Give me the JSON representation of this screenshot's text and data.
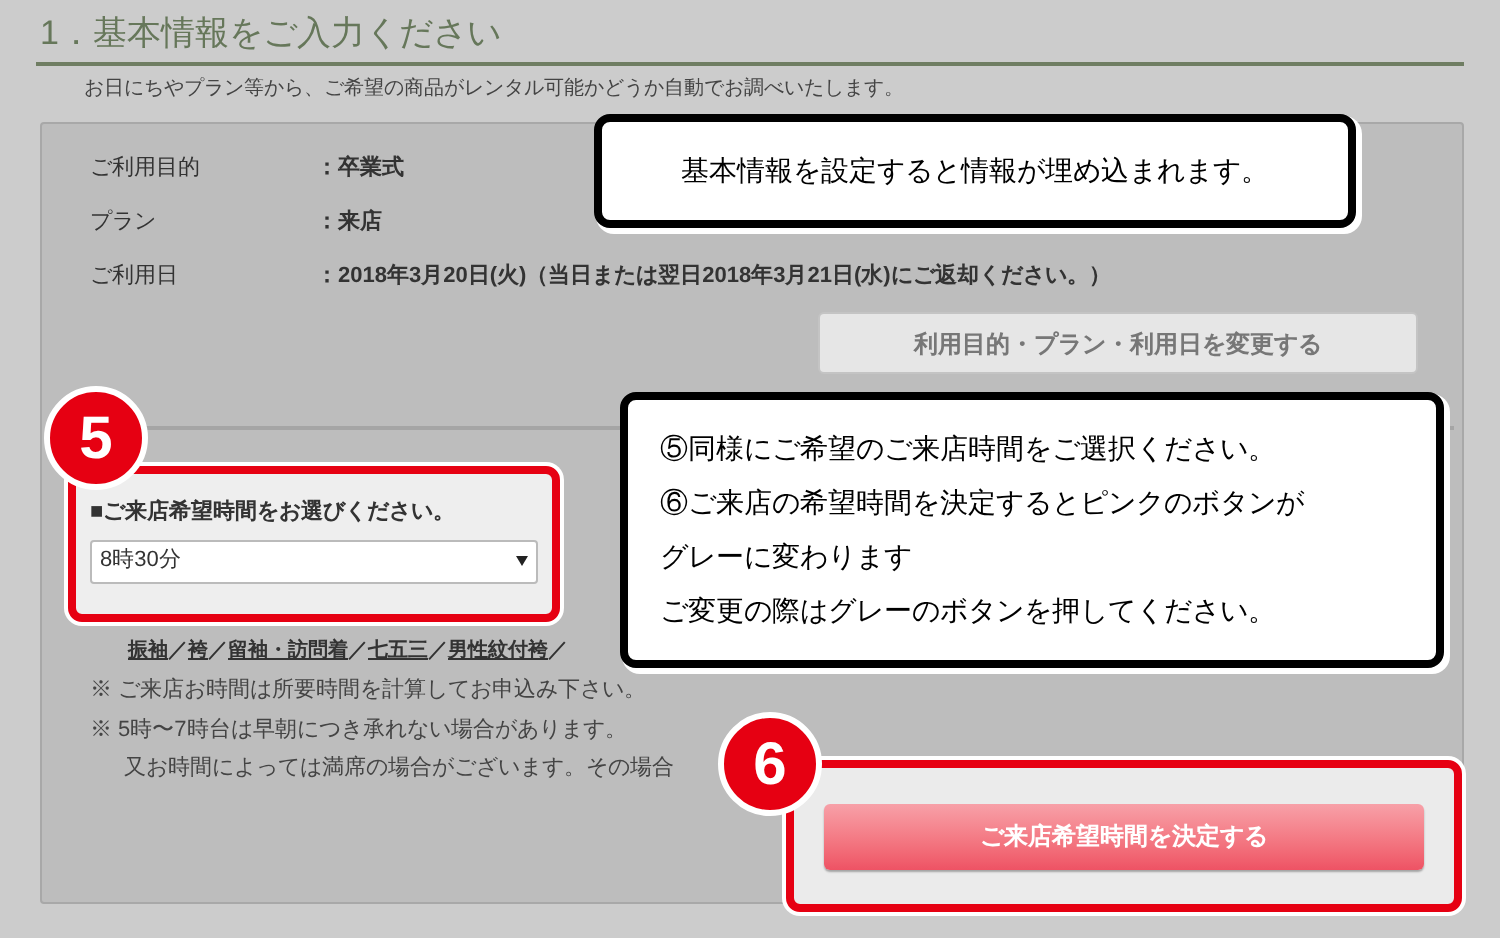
{
  "section": {
    "title": "1．基本情報をご入力ください",
    "subtitle": "お日にちやプラン等から、ご希望の商品がレンタル可能かどうか自動でお調べいたします。"
  },
  "info_rows": [
    {
      "label": "ご利用目的",
      "value": "：卒業式"
    },
    {
      "label": "プラン",
      "value": "：来店"
    },
    {
      "label": "ご利用日",
      "value": "：2018年3月20日(火)（当日または翌日2018年3月21日(水)にご返却ください。）"
    }
  ],
  "change_button": "利用目的・プラン・利用日を変更する",
  "time_select": {
    "label": "■ご来店希望時間をお選びください。",
    "value": "8時30分"
  },
  "category_links": [
    {
      "label": "振袖",
      "separator": "／"
    },
    {
      "label": "袴",
      "separator": "／"
    },
    {
      "label": "留袖・訪問着",
      "separator": "／"
    },
    {
      "label": "七五三",
      "separator": "／"
    },
    {
      "label": "男性紋付袴",
      "separator": "／"
    }
  ],
  "notes": [
    "※ ご来店お時間は所要時間を計算してお申込み下さい。",
    "※ 5時〜7時台は早朝につき承れない場合があります。",
    "又お時間によっては満席の場合がございます。その場合"
  ],
  "decide_button": "ご来店希望時間を決定する",
  "callouts": [
    {
      "lines": [
        "基本情報を設定すると情報が埋め込まれます。"
      ]
    },
    {
      "lines": [
        "⑤同様にご希望のご来店時間をご選択ください。",
        "⑥ご来店の希望時間を決定するとピンクのボタンが",
        "グレーに変わります",
        "ご変更の際はグレーのボタンを押してください。"
      ]
    }
  ],
  "step_badges": [
    "5",
    "6"
  ]
}
